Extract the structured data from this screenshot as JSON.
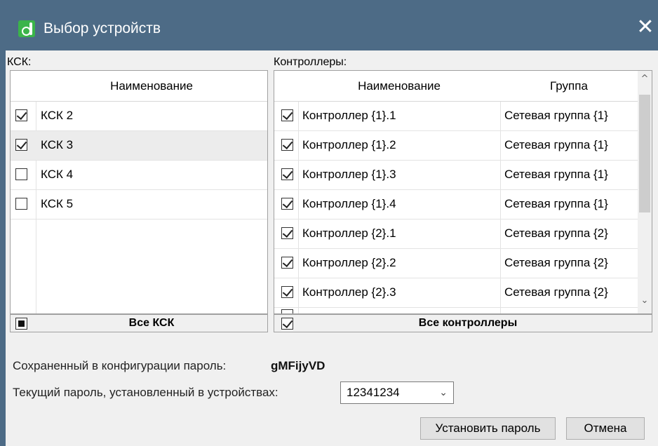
{
  "window": {
    "title": "Выбор устройств",
    "close_glyph": "✕",
    "icon": "app-logo-icon",
    "colors": {
      "titlebar": "#4d6b86",
      "body": "#f0f0f0"
    }
  },
  "ksk_panel": {
    "label": "КСК:",
    "column_header": "Наименование",
    "rows": [
      {
        "name": "КСК 2",
        "checked": true
      },
      {
        "name": "КСК 3",
        "checked": true
      },
      {
        "name": "КСК 4",
        "checked": false
      },
      {
        "name": "КСК 5",
        "checked": false
      }
    ],
    "footer_label": "Все КСК",
    "footer_state": "indeterminate"
  },
  "controllers_panel": {
    "label": "Контроллеры:",
    "columns": [
      "Наименование",
      "Группа"
    ],
    "rows": [
      {
        "name": "Контроллер {1}.1",
        "group": "Сетевая группа {1}",
        "checked": true
      },
      {
        "name": "Контроллер {1}.2",
        "group": "Сетевая группа {1}",
        "checked": true
      },
      {
        "name": "Контроллер {1}.3",
        "group": "Сетевая группа {1}",
        "checked": true
      },
      {
        "name": "Контроллер {1}.4",
        "group": "Сетевая группа {1}",
        "checked": true
      },
      {
        "name": "Контроллер {2}.1",
        "group": "Сетевая группа {2}",
        "checked": true
      },
      {
        "name": "Контроллер {2}.2",
        "group": "Сетевая группа {2}",
        "checked": true
      },
      {
        "name": "Контроллер {2}.3",
        "group": "Сетевая группа {2}",
        "checked": true
      }
    ],
    "footer_label": "Все контроллеры",
    "footer_state": "checked",
    "scroll_up_glyph": "^",
    "scroll_down_glyph": "⌄"
  },
  "password": {
    "saved_label": "Сохраненный в конфигурации пароль:",
    "saved_value": "gMFijyVD",
    "current_label": "Текущий пароль, установленный в устройствах:",
    "current_value": "12341234",
    "dropdown_glyph": "⌄"
  },
  "buttons": {
    "set_password": "Установить пароль",
    "cancel": "Отмена"
  }
}
